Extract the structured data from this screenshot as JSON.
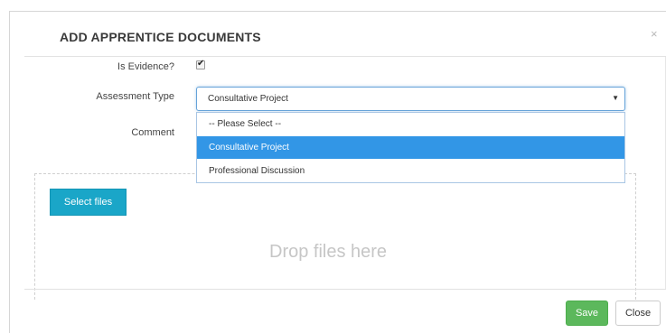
{
  "modal": {
    "title": "ADD APPRENTICE DOCUMENTS",
    "close_glyph": "×"
  },
  "form": {
    "evidence_label": "Is Evidence?",
    "evidence_checked": true,
    "assessment_label": "Assessment Type",
    "assessment_value": "Consultative Project",
    "comment_label": "Comment",
    "assessment_options": [
      {
        "label": "-- Please Select --",
        "selected": false
      },
      {
        "label": "Consultative Project",
        "selected": true
      },
      {
        "label": "Professional Discussion",
        "selected": false
      }
    ]
  },
  "upload": {
    "select_files_label": "Select files",
    "drop_text": "Drop files here"
  },
  "footer": {
    "save_label": "Save",
    "close_label": "Close"
  },
  "icons": {
    "check": "✔",
    "dropdown_arrow": "▼"
  },
  "colors": {
    "highlight": "#3296e6",
    "select_files_button": "#1aa6c8",
    "save_button": "#5cb85c"
  }
}
